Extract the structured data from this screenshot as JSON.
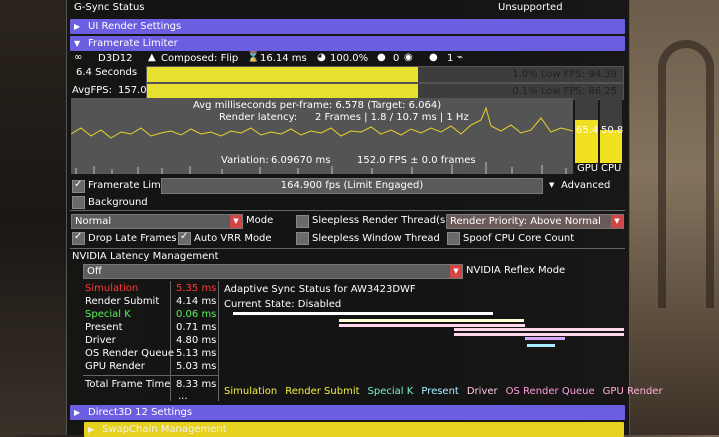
{
  "top": {
    "gsync_label": "G-Sync Status",
    "gsync_value": "Unsupported"
  },
  "sections": {
    "ui_render": "UI Render Settings",
    "framerate_limiter": "Framerate Limiter",
    "d3d12": "Direct3D 12 Settings",
    "swapchain": "SwapChain Management"
  },
  "stats": {
    "api": "D3D12",
    "composed": "Composed:  Flip",
    "frametime": "16.14 ms",
    "percent": "100.0%",
    "gamepads": "0",
    "controllers": "1",
    "seconds": "6.4  Seconds",
    "low1": "1.0% Low FPS: 94.39",
    "avg_label": "AvgFPS:",
    "avg_value": "157.0",
    "low01": "0.1% Low FPS: 86.25",
    "low1_frac": 0.57,
    "low01_frac": 0.57
  },
  "graph": {
    "avg_ms": "Avg milliseconds per-frame:  6.578  (Target:  6.064)",
    "latency_label": "Render latency:",
    "latency_value": "2 Frames  |  1.8 / 10.7 ms  |  1 Hz",
    "variation_label": "Variation:",
    "variation_value": "6.09670 ms",
    "fps_line": "152.0 FPS  ±  0.0 frames",
    "gpu_value": "65.4",
    "cpu_value": "50.8",
    "gpu_label": "GPU",
    "cpu_label": "CPU",
    "gpu_frac": 0.66,
    "cpu_frac": 0.51
  },
  "limiter": {
    "framerate_limit": "Framerate Limit",
    "fps_text": "164.900 fps  (Limit Engaged)",
    "advanced": "Advanced",
    "background": "Background",
    "mode_value": "Normal",
    "mode_label": "Mode",
    "sleepless_render": "Sleepless Render Thread(s)",
    "render_priority": "Render Priority:   Above Normal",
    "drop_late": "Drop Late Frames",
    "auto_vrr": "Auto VRR Mode",
    "sleepless_window": "Sleepless Window Thread",
    "spoof_cpu": "Spoof CPU Core Count"
  },
  "latency": {
    "title": "NVIDIA Latency Management",
    "reflex_value": "Off",
    "reflex_label": "NVIDIA Reflex Mode",
    "rows": [
      {
        "label": "Simulation",
        "value": "5.35 ms",
        "color": "#ff3a3a"
      },
      {
        "label": "Render Submit",
        "value": "4.14 ms",
        "color": "#ffffff"
      },
      {
        "label": "Special K",
        "value": "0.06 ms",
        "color": "#5cf05c"
      },
      {
        "label": "Present",
        "value": "0.71 ms",
        "color": "#ffffff"
      },
      {
        "label": "Driver",
        "value": "4.80 ms",
        "color": "#ffffff"
      },
      {
        "label": "OS Render Queue",
        "value": "5.13 ms",
        "color": "#ffffff"
      },
      {
        "label": "GPU Render",
        "value": "5.03 ms",
        "color": "#ffffff"
      }
    ],
    "total_label": "Total Frame Time",
    "total_value": "8.33 ms",
    "ellipsis": "...",
    "adaptive_title": "Adaptive Sync Status for AW3423DWF",
    "current_state": "Current State:  Disabled",
    "legend": [
      {
        "label": "Simulation",
        "color": "#f0f040"
      },
      {
        "label": "Render Submit",
        "color": "#f0f040"
      },
      {
        "label": "Special K",
        "color": "#7ef0d0"
      },
      {
        "label": "Present",
        "color": "#a8f0ff"
      },
      {
        "label": "Driver",
        "color": "#ffc8e8"
      },
      {
        "label": "OS Render Queue",
        "color": "#ff9ee0"
      },
      {
        "label": "GPU Render",
        "color": "#ffb0d8"
      }
    ]
  }
}
